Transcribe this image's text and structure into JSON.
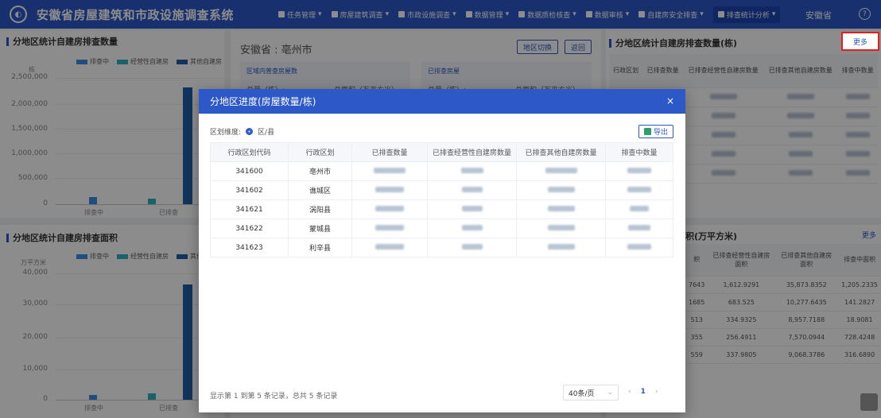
{
  "app": {
    "title": "安徽省房屋建筑和市政设施调查系统",
    "user": "安徽省"
  },
  "nav": [
    {
      "label": "任务管理",
      "icon": "task-icon"
    },
    {
      "label": "房屋建筑调查",
      "icon": "house-icon"
    },
    {
      "label": "市政设施调查",
      "icon": "bridge-icon"
    },
    {
      "label": "数据管理",
      "icon": "data-icon"
    },
    {
      "label": "数据质检核查",
      "icon": "check-icon"
    },
    {
      "label": "数据审核",
      "icon": "review-icon"
    },
    {
      "label": "自建房安全排查",
      "icon": "safety-icon"
    },
    {
      "label": "排查统计分析",
      "icon": "stats-icon"
    }
  ],
  "left_top": {
    "title": "分地区统计自建房排查数量",
    "unit": "栋",
    "legend": [
      "排查中",
      "经营性自建房",
      "其他自建房"
    ],
    "yticks": [
      "2,500,000",
      "2,000,000",
      "1,500,000",
      "1,000,000",
      "500,000",
      "0"
    ],
    "xlabels": [
      "排查中",
      "已排查"
    ]
  },
  "left_bottom": {
    "title": "分地区统计自建房排查面积",
    "unit": "万平方米",
    "legend": [
      "排查中",
      "经营性自建房",
      "其他自建房"
    ],
    "yticks": [
      "40,000",
      "30,000",
      "20,000",
      "10,000",
      "0"
    ],
    "xlabels": [
      "排查中",
      "已排查"
    ]
  },
  "middle": {
    "breadcrumb": "安徽省 : 亳州市",
    "switch_label": "地区切换",
    "back_label": "返回",
    "section1": "区域内普查房屋数",
    "section2": "已排查房屋",
    "total_count_label": "总量（栋）:",
    "total_area_label": "总面积（万平方米）"
  },
  "right_top": {
    "title": "分地区统计自建房排查数量(栋)",
    "more": "更多",
    "headers": [
      "行政区划",
      "已排查数量",
      "已排查经营性自建房数量",
      "已排查其他自建房数量",
      "排查中数量"
    ]
  },
  "right_bottom": {
    "title_partial": "积(万平方米)",
    "more": "更多",
    "headers": [
      "积",
      "已排查经营性自建房面积",
      "已排查其他自建房面积",
      "排查中面积"
    ],
    "rows": [
      [
        "7643",
        "1,612.9291",
        "35,873.8352",
        "1,205.2335"
      ],
      [
        "1685",
        "683.525",
        "10,277.6435",
        "141.2827"
      ],
      [
        "513",
        "334.9325",
        "8,957.7188",
        "18.9081"
      ],
      [
        "355",
        "256.4911",
        "7,570.0944",
        "728.4248"
      ],
      [
        "559",
        "337.9805",
        "9,068.3786",
        "316.6890"
      ]
    ]
  },
  "modal": {
    "title": "分地区进度(房屋数量/栋)",
    "close": "×",
    "dimension_label": "区划维度:",
    "dimension_option": "区/县",
    "export_label": "导出",
    "headers": [
      "行政区划代码",
      "行政区划",
      "已排查数量",
      "已排查经营性自建房数量",
      "已排查其他自建房数量",
      "排查中数量"
    ],
    "rows": [
      {
        "code": "341600",
        "name": "亳州市"
      },
      {
        "code": "341602",
        "name": "谯城区"
      },
      {
        "code": "341621",
        "name": "涡阳县"
      },
      {
        "code": "341622",
        "name": "蒙城县"
      },
      {
        "code": "341623",
        "name": "利辛县"
      }
    ],
    "footer": "显示第 1 到第 5 条记录，总共 5 条记录",
    "page_size": "40条/页",
    "page": "1",
    "prev": "‹",
    "next": "›"
  },
  "colors": {
    "brand": "#2d58c8",
    "series1": "#3a8ee6",
    "series2": "#2bb3c4",
    "series3": "#1e5fa8",
    "highlight": "#e02020"
  }
}
